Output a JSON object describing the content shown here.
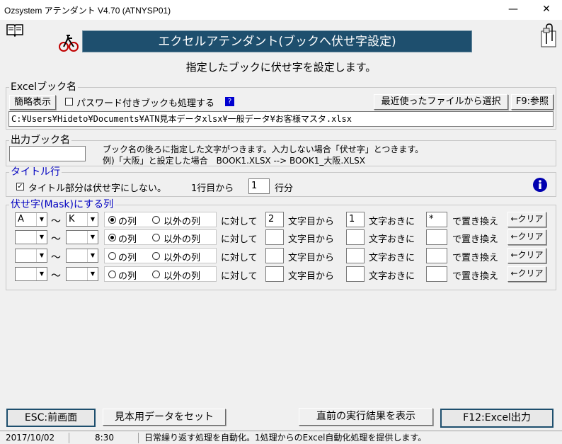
{
  "window": {
    "title": "Ozsystem アテンダント V4.70 (ATNYSP01)",
    "minimize": "—",
    "close": "✕"
  },
  "header": {
    "banner": "エクセルアテンダント(ブックへ伏せ字設定)",
    "subtitle": "指定したブックに伏せ字を設定します。",
    "book_icon": "book-icon",
    "bike_icon": "bicycle-icon",
    "clip_icon": "paperclip-icon"
  },
  "excel_book": {
    "title": "Excelブック名",
    "brief_button": "簡略表示",
    "password_checkbox_label": "パスワード付きブックも処理する",
    "password_checked": false,
    "help_badge": "?",
    "recent_button": "最近使ったファイルから選択",
    "browse_button": "F9:参照",
    "path_value": "C:¥Users¥Hideto¥Documents¥ATN見本データxlsx¥一般データ¥お客様マスタ.xlsx"
  },
  "output_book": {
    "title": "出力ブック名",
    "value": "",
    "note_line1": "ブック名の後ろに指定した文字がつきます。入力しない場合「伏せ字」とつきます。",
    "note_line2": "例)「大阪」と設定した場合　BOOK1.XLSX --> BOOK1_大阪.XLSX"
  },
  "title_row": {
    "title": "タイトル行",
    "checkbox_label": "タイトル部分は伏せ字にしない。",
    "checked": true,
    "from_label": "1行目から",
    "row_value": "1",
    "row_suffix": "行分",
    "info_icon": "info-icon"
  },
  "mask_columns": {
    "title": "伏せ字(Mask)にする列",
    "tilde": "〜",
    "opt_in": "の列",
    "opt_out": "以外の列",
    "against": "に対して",
    "from_char": "文字目から",
    "every_char": "文字おきに",
    "replace_with": "で置き換え",
    "clear_button": "←クリア",
    "rows": [
      {
        "from_col": "A",
        "to_col": "K",
        "mode": "in",
        "start": "2",
        "every": "1",
        "char": "*"
      },
      {
        "from_col": "",
        "to_col": "",
        "mode": "in",
        "start": "",
        "every": "",
        "char": ""
      },
      {
        "from_col": "",
        "to_col": "",
        "mode": "none",
        "start": "",
        "every": "",
        "char": ""
      },
      {
        "from_col": "",
        "to_col": "",
        "mode": "none",
        "start": "",
        "every": "",
        "char": ""
      }
    ]
  },
  "footer": {
    "esc_button": "ESC:前画面",
    "sample_button": "見本用データをセット",
    "last_result_button": "直前の実行結果を表示",
    "run_button": "F12:Excel出力"
  },
  "statusbar": {
    "date": "2017/10/02",
    "time": "8:30",
    "message": "日常繰り返す処理を自動化。1処理からのExcel自動化処理を提供します。"
  }
}
